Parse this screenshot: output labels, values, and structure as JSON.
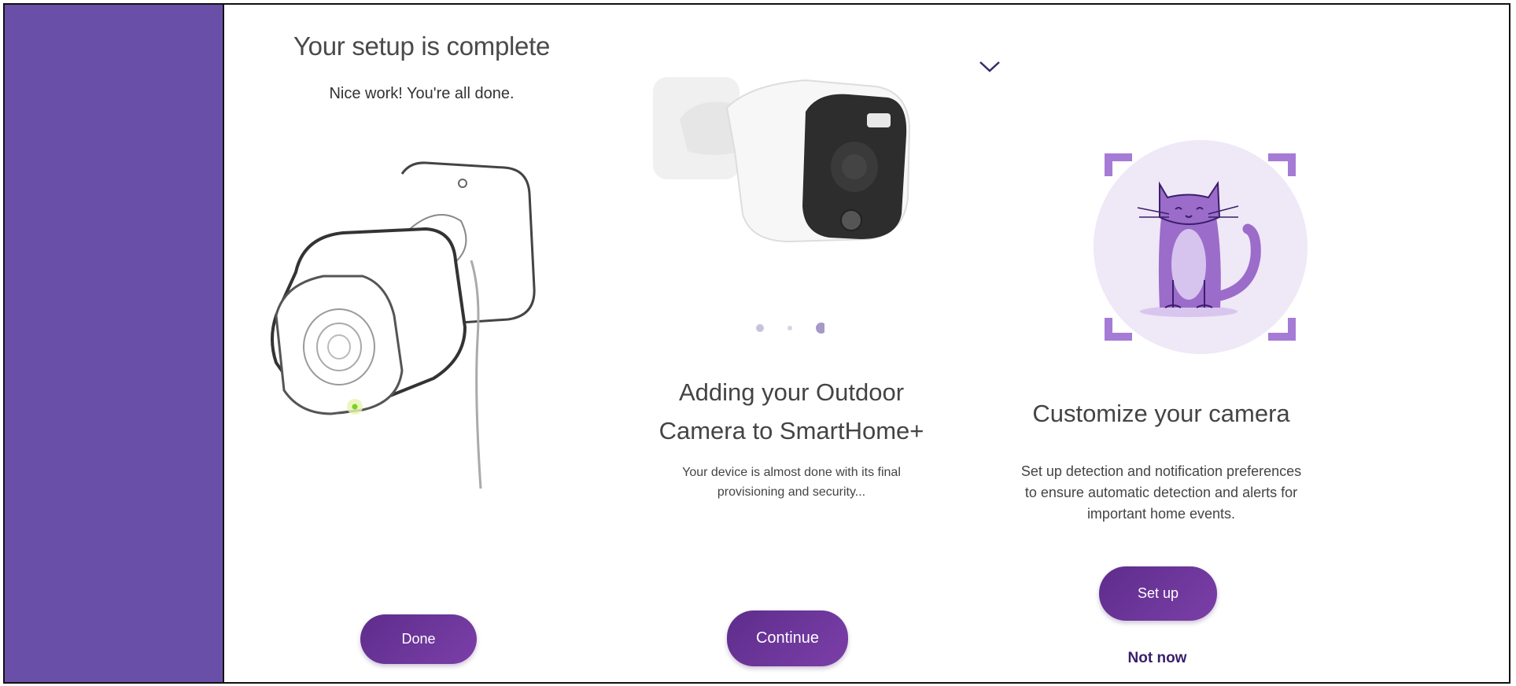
{
  "colors": {
    "sidebar": "#6a4fa8",
    "button": "#6a339a",
    "link": "#3a1e6b",
    "cat_bg": "#efe8f7",
    "cat_body": "#9b6cc9"
  },
  "panel_complete": {
    "title": "Your setup is complete",
    "subtitle": "Nice work! You're all done.",
    "button_label": "Done"
  },
  "panel_adding": {
    "title_line1": "Adding your Outdoor",
    "title_line2": "Camera to SmartHome+",
    "body_line1": "Your device is almost done with its final",
    "body_line2": "provisioning and security...",
    "button_label": "Continue",
    "carousel": {
      "total": 3,
      "active": 3
    }
  },
  "panel_customize": {
    "title": "Customize your camera",
    "body_line1": "Set up detection and notification preferences",
    "body_line2": "to ensure automatic detection and alerts for",
    "body_line3": "important home events.",
    "primary_label": "Set up",
    "secondary_label": "Not now"
  },
  "icons": {
    "chevron": "chevron-down-icon",
    "camera_indoor": "camera-illustration",
    "camera_outdoor": "camera-photo",
    "cat": "cat-illustration"
  }
}
